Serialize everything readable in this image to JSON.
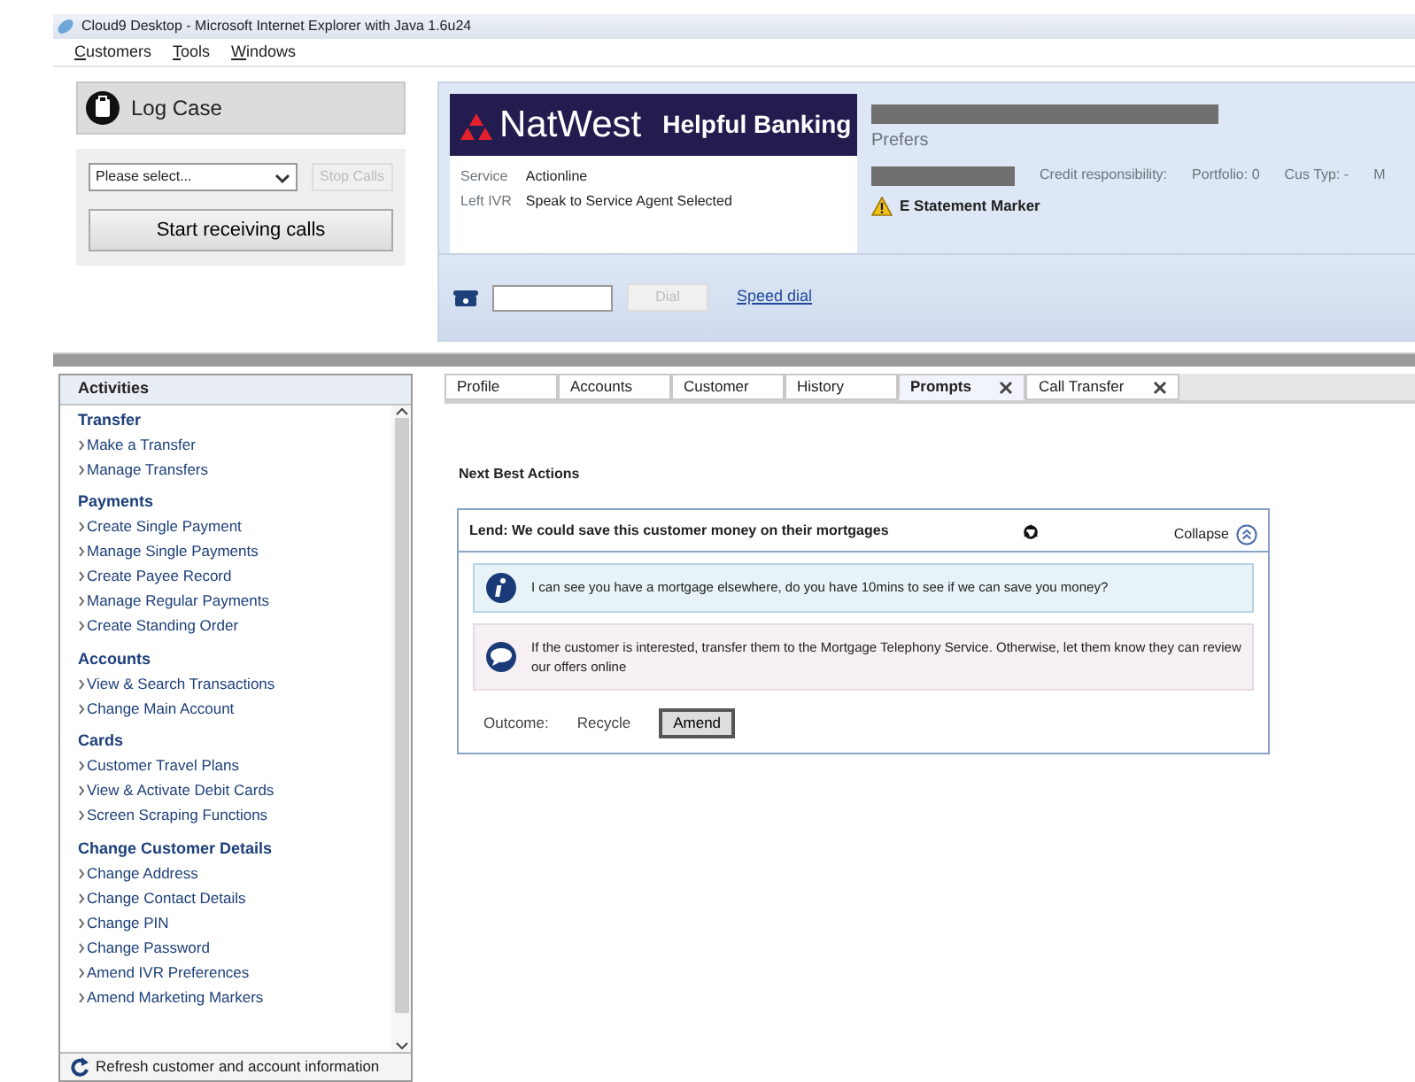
{
  "window": {
    "title": "Cloud9 Desktop - Microsoft Internet Explorer with Java 1.6u24"
  },
  "menu": [
    {
      "label": "Customers"
    },
    {
      "label": "Tools"
    },
    {
      "label": "Windows"
    }
  ],
  "log_case": {
    "label": "Log Case"
  },
  "call_controls": {
    "select_value": "Please select...",
    "stop_button": {
      "label": "Stop Calls",
      "disabled": true
    },
    "start_button": {
      "label": "Start receiving calls",
      "disabled": false
    }
  },
  "brand": {
    "name": "NatWest",
    "tagline": "Helpful Banking"
  },
  "call_info": [
    {
      "label": "Service",
      "value": "Actionline"
    },
    {
      "label": "Left IVR",
      "value": "Speak to Service Agent Selected"
    }
  ],
  "dial": {
    "dial_button": {
      "label": "Dial",
      "disabled": true
    },
    "speed_dial": "Speed dial"
  },
  "customer": {
    "prefers": "Prefers",
    "fields": [
      "Credit responsibility:",
      "Portfolio: 0",
      "Cus Typ: -",
      "M"
    ],
    "marker": "E Statement Marker"
  },
  "activities": {
    "title": "Activities",
    "groups": [
      {
        "title": "Transfer",
        "items": [
          "Make a Transfer",
          "Manage Transfers"
        ]
      },
      {
        "title": "Payments",
        "items": [
          "Create Single Payment",
          "Manage Single Payments",
          "Create Payee Record",
          "Manage Regular Payments",
          "Create Standing Order"
        ]
      },
      {
        "title": "Accounts",
        "items": [
          "View & Search Transactions",
          "Change Main Account"
        ]
      },
      {
        "title": "Cards",
        "items": [
          "Customer Travel Plans",
          "View & Activate Debit Cards",
          "Screen Scraping Functions"
        ]
      },
      {
        "title": "Change Customer Details",
        "items": [
          "Change Address",
          "Change Contact Details",
          "Change PIN",
          "Change Password",
          "Amend IVR Preferences",
          "Amend Marketing Markers"
        ]
      }
    ],
    "refresh": "Refresh customer and account information"
  },
  "tabs": [
    {
      "label": "Profile",
      "selected": false,
      "closable": false
    },
    {
      "label": "Accounts",
      "selected": false,
      "closable": false
    },
    {
      "label": "Customer",
      "selected": false,
      "closable": false
    },
    {
      "label": "History",
      "selected": false,
      "closable": false
    },
    {
      "label": "Prompts",
      "selected": true,
      "closable": true
    },
    {
      "label": "Call Transfer",
      "selected": false,
      "closable": true
    }
  ],
  "prompts": {
    "title": "Next Best Actions",
    "card": {
      "title": "Lend: We could save this customer money on their mortgages",
      "collapse": "Collapse",
      "messages": [
        {
          "kind": "info",
          "text": "I can see you have a mortgage elsewhere, do you have 10mins to see if we can save you money?"
        },
        {
          "kind": "speech",
          "text": "If the customer is interested, transfer them to the Mortgage Telephony Service. Otherwise, let them know they can review our offers online"
        }
      ],
      "outcome_label": "Outcome:",
      "outcomes": [
        {
          "label": "Recycle",
          "kind": "text"
        },
        {
          "label": "Amend",
          "kind": "button"
        }
      ]
    }
  }
}
